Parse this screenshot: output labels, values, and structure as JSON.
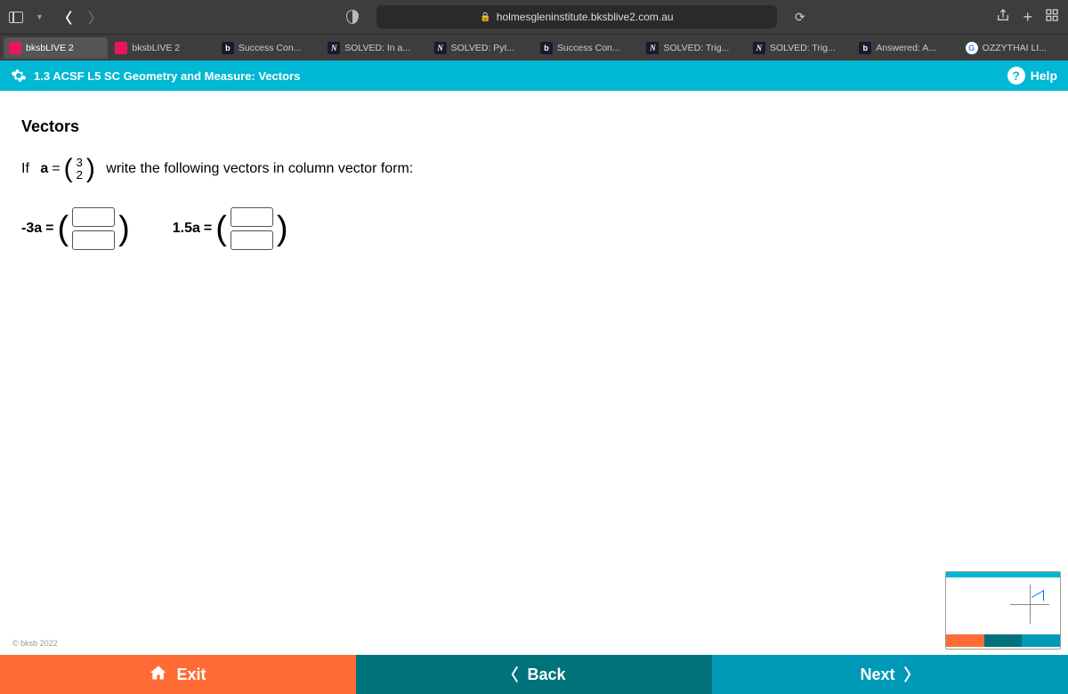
{
  "browser": {
    "url": "holmesgleninstitute.bksblive2.com.au"
  },
  "tabs": [
    {
      "label": "bksbLIVE 2",
      "favicon": "pink"
    },
    {
      "label": "bksbLIVE 2",
      "favicon": "pink"
    },
    {
      "label": "Success Con...",
      "favicon": "blue"
    },
    {
      "label": "SOLVED: In a...",
      "favicon": "letter"
    },
    {
      "label": "SOLVED: Pyt...",
      "favicon": "letter"
    },
    {
      "label": "Success Con...",
      "favicon": "blue"
    },
    {
      "label": "SOLVED: Trig...",
      "favicon": "letter"
    },
    {
      "label": "SOLVED: Trig...",
      "favicon": "letter"
    },
    {
      "label": "Answered: A...",
      "favicon": "blue"
    },
    {
      "label": "OZZYTHAI LI...",
      "favicon": "google"
    }
  ],
  "header": {
    "title": "1.3 ACSF L5 SC Geometry and Measure: Vectors",
    "help": "Help"
  },
  "content": {
    "section_title": "Vectors",
    "prompt_prefix": "If",
    "prompt_a": "a",
    "prompt_equals": "=",
    "vector_top": "3",
    "vector_bottom": "2",
    "prompt_suffix": "write the following vectors in column vector form:",
    "q1_label": "-3a",
    "q2_label": "1.5a",
    "equals": "=",
    "paren_l": "(",
    "paren_r": ")"
  },
  "footer": {
    "copyright": "© bksb 2022"
  },
  "nav": {
    "exit": "Exit",
    "back": "Back",
    "next": "Next"
  }
}
